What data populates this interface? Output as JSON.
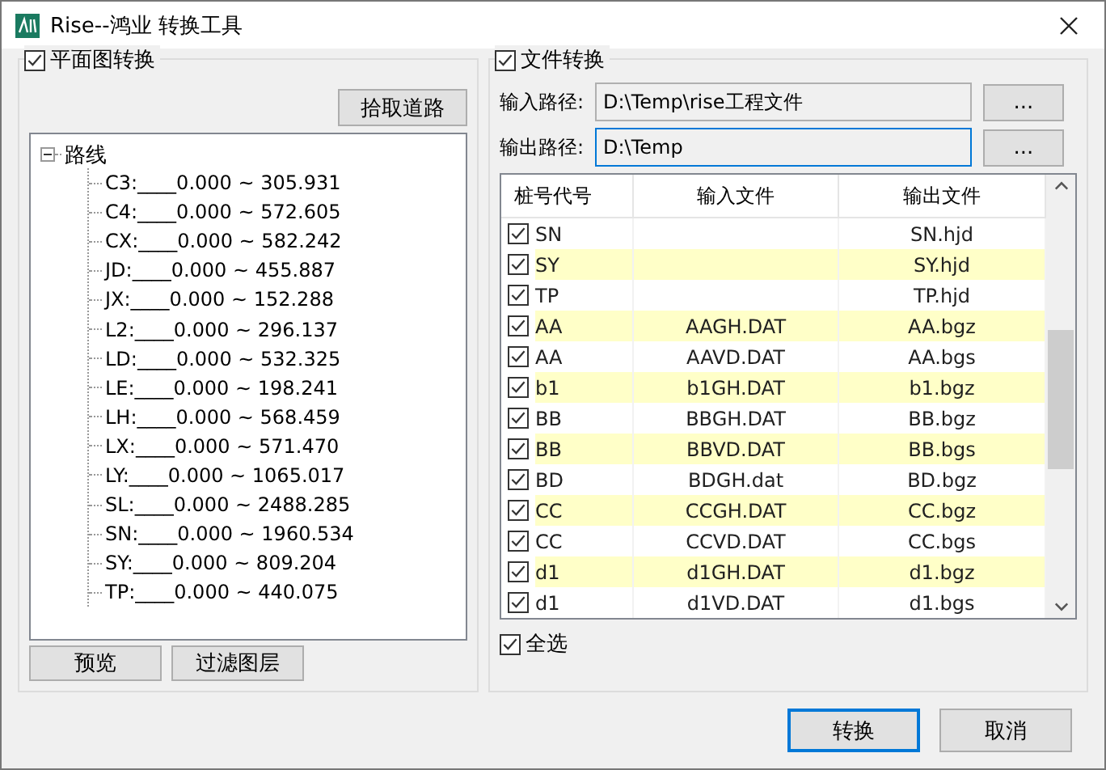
{
  "window": {
    "title": "Rise--鸿业 转换工具"
  },
  "plan_group": {
    "label": "平面图转换",
    "checked": true,
    "pick_button": "拾取道路",
    "tree": {
      "label": "路线",
      "expanded": true,
      "children": [
        {
          "label": "C3:____0.000 ~ 305.931"
        },
        {
          "label": "C4:____0.000 ~ 572.605"
        },
        {
          "label": "CX:____0.000 ~ 582.242"
        },
        {
          "label": "JD:____0.000 ~ 455.887"
        },
        {
          "label": "JX:____0.000 ~ 152.288"
        },
        {
          "label": "L2:____0.000 ~ 296.137"
        },
        {
          "label": "LD:____0.000 ~ 532.325"
        },
        {
          "label": "LE:____0.000 ~ 198.241"
        },
        {
          "label": "LH:____0.000 ~ 568.459"
        },
        {
          "label": "LX:____0.000 ~ 571.470"
        },
        {
          "label": "LY:____0.000 ~ 1065.017"
        },
        {
          "label": "SL:____0.000 ~ 2488.285"
        },
        {
          "label": "SN:____0.000 ~ 1960.534"
        },
        {
          "label": "SY:____0.000 ~ 809.204"
        },
        {
          "label": "TP:____0.000 ~ 440.075"
        }
      ]
    },
    "buttons": [
      "预览",
      "过滤图层"
    ]
  },
  "file_group": {
    "label": "文件转换",
    "checked": true,
    "input_path": {
      "label": "输入路径:",
      "value": "D:\\Temp\\rise工程文件",
      "browse": "..."
    },
    "output_path": {
      "label": "输出路径:",
      "value": "D:\\Temp",
      "browse": "...",
      "focused": true
    },
    "table": {
      "columns": [
        "桩号代号",
        "输入文件",
        "输出文件"
      ],
      "rows": [
        {
          "checked": true,
          "code": "SN",
          "input": "",
          "output": "SN.hjd",
          "highlighted": false
        },
        {
          "checked": true,
          "code": "SY",
          "input": "",
          "output": "SY.hjd",
          "highlighted": true
        },
        {
          "checked": true,
          "code": "TP",
          "input": "",
          "output": "TP.hjd",
          "highlighted": false
        },
        {
          "checked": true,
          "code": "AA",
          "input": "AAGH.DAT",
          "output": "AA.bgz",
          "highlighted": true
        },
        {
          "checked": true,
          "code": "AA",
          "input": "AAVD.DAT",
          "output": "AA.bgs",
          "highlighted": false
        },
        {
          "checked": true,
          "code": "b1",
          "input": "b1GH.DAT",
          "output": "b1.bgz",
          "highlighted": true
        },
        {
          "checked": true,
          "code": "BB",
          "input": "BBGH.DAT",
          "output": "BB.bgz",
          "highlighted": false
        },
        {
          "checked": true,
          "code": "BB",
          "input": "BBVD.DAT",
          "output": "BB.bgs",
          "highlighted": true
        },
        {
          "checked": true,
          "code": "BD",
          "input": "BDGH.dat",
          "output": "BD.bgz",
          "highlighted": false
        },
        {
          "checked": true,
          "code": "CC",
          "input": "CCGH.DAT",
          "output": "CC.bgz",
          "highlighted": true
        },
        {
          "checked": true,
          "code": "CC",
          "input": "CCVD.DAT",
          "output": "CC.bgs",
          "highlighted": false
        },
        {
          "checked": true,
          "code": "d1",
          "input": "d1GH.DAT",
          "output": "d1.bgz",
          "highlighted": true
        },
        {
          "checked": true,
          "code": "d1",
          "input": "d1VD.DAT",
          "output": "d1.bgs",
          "highlighted": false
        }
      ]
    },
    "select_all": {
      "label": "全选",
      "checked": true
    }
  },
  "buttons": [
    {
      "label": "转换",
      "default": true
    },
    {
      "label": "取消",
      "default": false
    }
  ]
}
